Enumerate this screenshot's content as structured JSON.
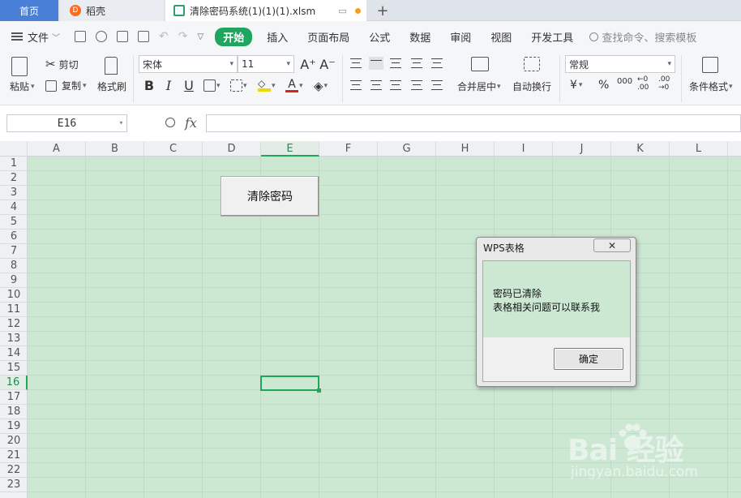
{
  "tabs": {
    "home": "首页",
    "daoke": "稻壳",
    "daoke_logo": "D",
    "file": "清除密码系统(1)(1)(1).xlsm",
    "plus": "+"
  },
  "menu": {
    "file": "文件",
    "items": [
      "开始",
      "插入",
      "页面布局",
      "公式",
      "数据",
      "审阅",
      "视图",
      "开发工具"
    ],
    "search": "查找命令、搜索模板"
  },
  "ribbon": {
    "paste": "粘贴",
    "cut": "剪切",
    "copy": "复制",
    "format_painter": "格式刷",
    "font_name": "宋体",
    "font_size": "11",
    "bold": "B",
    "italic": "I",
    "underline": "U",
    "grow": "A⁺",
    "shrink": "A⁻",
    "merge_center": "合并居中",
    "wrap_text": "自动换行",
    "number_format": "常规",
    "currency": "¥",
    "percent": "%",
    "thousands": "000",
    "inc_decimal": "←0 .00",
    "dec_decimal": ".00 →0",
    "conditional_format": "条件格式"
  },
  "formula_bar": {
    "name_box": "E16",
    "fx": "fx",
    "value": ""
  },
  "grid": {
    "columns": [
      "A",
      "B",
      "C",
      "D",
      "E",
      "F",
      "G",
      "H",
      "I",
      "J",
      "K",
      "L"
    ],
    "selected_column": "E",
    "rows": [
      "1",
      "2",
      "3",
      "4",
      "5",
      "6",
      "7",
      "8",
      "9",
      "10",
      "11",
      "12",
      "13",
      "14",
      "15",
      "16",
      "17",
      "18",
      "19",
      "20",
      "21",
      "22",
      "23"
    ],
    "selected_row": "16"
  },
  "sheet_button": {
    "label": "清除密码"
  },
  "dialog": {
    "title": "WPS表格",
    "close": "✕",
    "line1": "密码已清除",
    "line2": "表格相关问题可以联系我",
    "ok": "确定"
  },
  "watermark": {
    "main": "Bai  经验",
    "sub": "jingyan.baidu.com"
  },
  "colors": {
    "accent": "#1fa55d",
    "sheet_bg": "#cce8d3",
    "home_tab": "#4a7fd8"
  }
}
